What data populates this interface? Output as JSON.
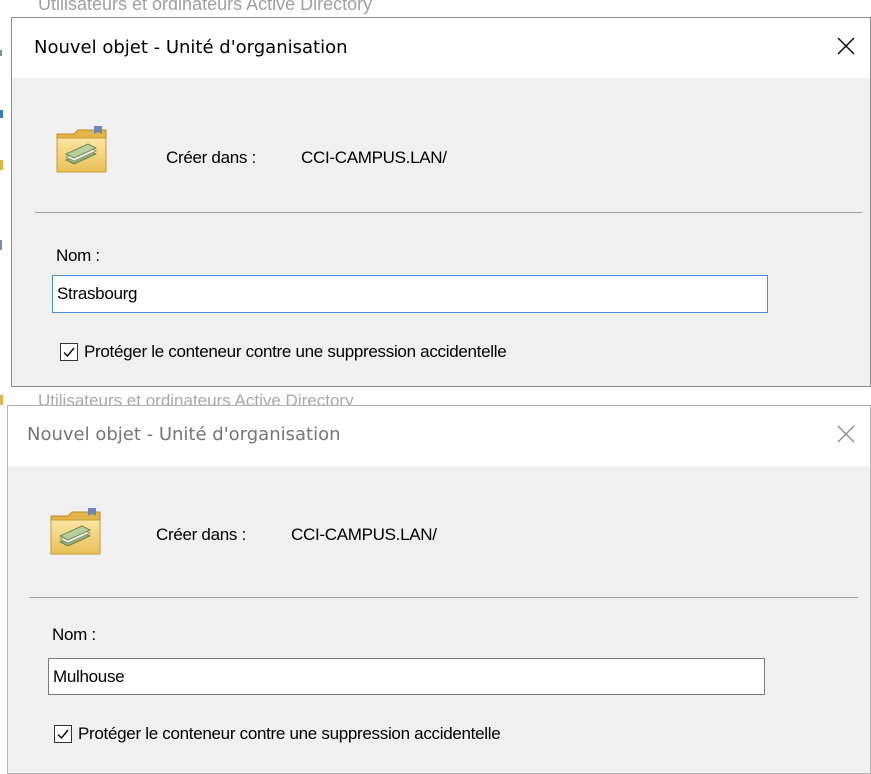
{
  "background": {
    "window_title": "Utilisateurs et ordinateurs Active Directory",
    "partial_title": "Utilisateurs et ordinateurs Active Directory"
  },
  "dialogs": [
    {
      "title": "Nouvel objet - Unité d'organisation",
      "create_in_label": "Créer dans :",
      "create_in_value": "CCI-CAMPUS.LAN/",
      "name_label": "Nom :",
      "name_value": "Strasbourg",
      "protect_label": "Protéger le conteneur contre une suppression accidentelle",
      "protect_checked": true,
      "close_icon": "close-icon",
      "folder_icon": "ou-folder-icon"
    },
    {
      "title": "Nouvel objet - Unité d'organisation",
      "create_in_label": "Créer dans :",
      "create_in_value": "CCI-CAMPUS.LAN/",
      "name_label": "Nom :",
      "name_value": "Mulhouse",
      "protect_label": "Protéger le conteneur contre une suppression accidentelle",
      "protect_checked": true,
      "close_icon": "close-icon",
      "folder_icon": "ou-folder-icon"
    }
  ],
  "colors": {
    "dialog_bg": "#f0f0f0",
    "titlebar_bg": "#ffffff",
    "input_focus_border": "#4a8fd6",
    "folder_yellow": "#f5d57a"
  }
}
